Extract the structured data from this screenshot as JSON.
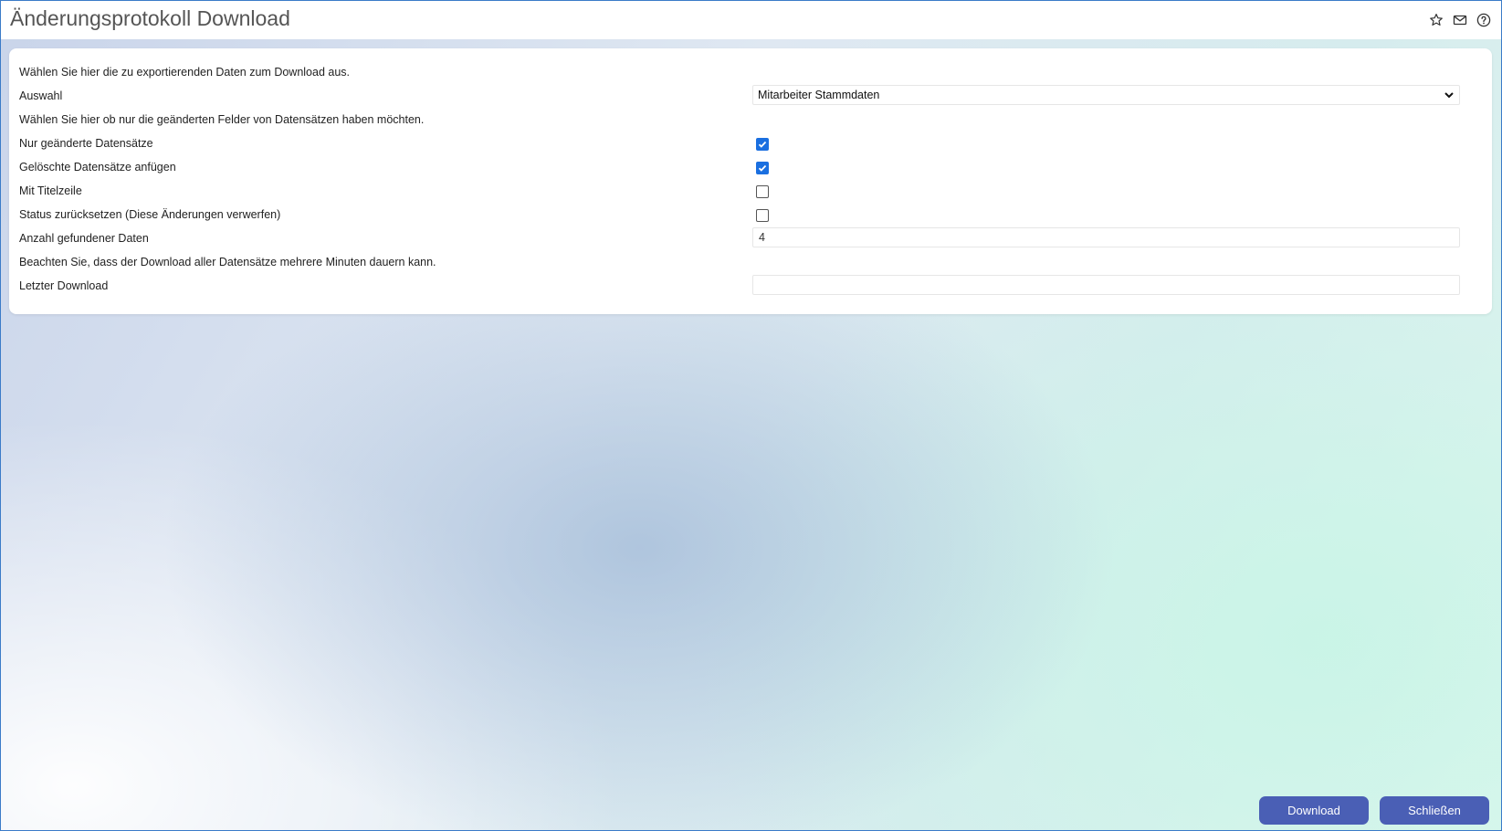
{
  "header": {
    "title": "Änderungsprotokoll Download",
    "icons": [
      "star-icon",
      "mail-icon",
      "help-icon"
    ]
  },
  "form": {
    "intro_text": "Wählen Sie hier die zu exportierenden Daten zum Download aus.",
    "auswahl_label": "Auswahl",
    "auswahl_value": "Mitarbeiter Stammdaten",
    "felder_text": "Wählen Sie hier ob nur die geänderten Felder von Datensätzen haben möchten.",
    "nur_geaenderte_label": "Nur geänderte Datensätze",
    "nur_geaenderte_checked": true,
    "geloeschte_label": "Gelöschte Datensätze anfügen",
    "geloeschte_checked": true,
    "titelzeile_label": "Mit Titelzeile",
    "titelzeile_checked": false,
    "status_label": "Status zurücksetzen (Diese Änderungen verwerfen)",
    "status_checked": false,
    "anzahl_label": "Anzahl gefundener Daten",
    "anzahl_value": "4",
    "hinweis_text": "Beachten Sie, dass der Download aller Datensätze mehrere Minuten dauern kann.",
    "letzter_label": "Letzter Download",
    "letzter_value": ""
  },
  "footer": {
    "download_label": "Download",
    "close_label": "Schließen"
  },
  "colors": {
    "accent": "#4a5fb5",
    "checkbox": "#1a6fe0",
    "border": "#3b7bc8"
  }
}
